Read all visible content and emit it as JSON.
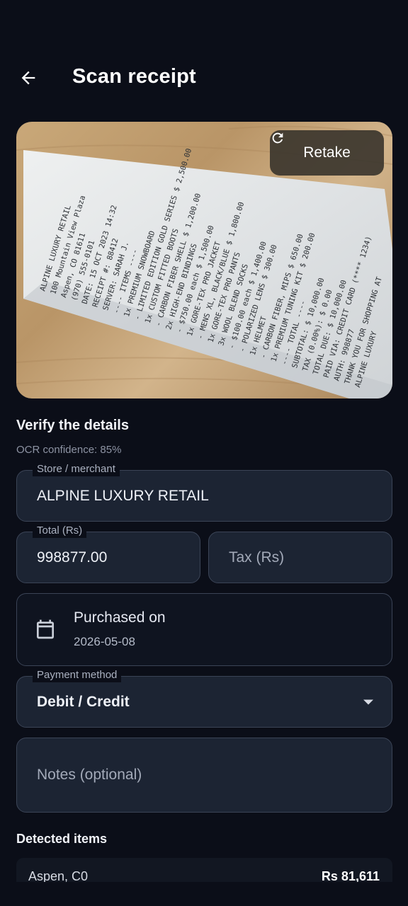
{
  "header": {
    "title": "Scan receipt",
    "back_icon": "arrow-left-icon"
  },
  "photo": {
    "retake_label": "Retake",
    "retake_icon": "refresh-icon",
    "receipt_lines": [
      "ALPINE LUXURY RETAIL",
      "100 Mountain View Plaza",
      "Aspen, CO 81611",
      "(970) 555-0101",
      "DATE: 15 OCT 2023 14:32",
      "RECEIPT #: 88412",
      "SERVER: SARAH J.",
      "---- ITEMS ----",
      "1x PREMIUM SNOWBOARD",
      " - LIMITED EDITION GOLD SERIES $ 2,500.00",
      "1x CUSTOM FITTED BOOTS",
      " - CARBON FIBER SHELL $ 1,200.00",
      "2x HIGH-END BINDINGS",
      " - $750.00 each $ 1,500.00",
      "1x GORE-TEX PRO JACKET",
      " - MENS XL, BLACK/BLUE $ 1,800.00",
      "1x GORE-TEX PRO PANTS",
      "3x WOOL BLEND SOCKS",
      " - $100.00 each $ 1,400.00",
      " - POLARIZED LENS $ 300.00",
      "1x HELMET",
      " - CARBON FIBER, MIPS $ 650.00",
      "1x PREMIUM TUNING KIT $ 200.00",
      "---- TOTAL ----",
      "SUBTOTAL: $ 10,000.00",
      "TAX (0.00%): $ 0.00",
      "TOTAL DUE: $ 10,000.00",
      "PAID VIA: CREDIT CARD (**** 1234)",
      "AUTH: 998877",
      "THANK YOU FOR SHOPPING AT",
      "ALPINE LUXURY"
    ]
  },
  "verify": {
    "title": "Verify the details",
    "confidence": "OCR confidence: 85%"
  },
  "form": {
    "store_label": "Store / merchant",
    "store_value": "ALPINE LUXURY RETAIL",
    "total_label": "Total (Rs)",
    "total_value": "998877.00",
    "tax_placeholder": "Tax (Rs)",
    "date_title": "Purchased on",
    "date_value": "2026-05-08",
    "date_icon": "calendar-icon",
    "payment_label": "Payment method",
    "payment_value": "Debit / Credit",
    "payment_icon": "dropdown-arrow-icon",
    "notes_placeholder": "Notes (optional)"
  },
  "detected": {
    "title": "Detected items",
    "items": [
      {
        "name": "Aspen, C0",
        "amount": "Rs 81,611"
      }
    ]
  }
}
